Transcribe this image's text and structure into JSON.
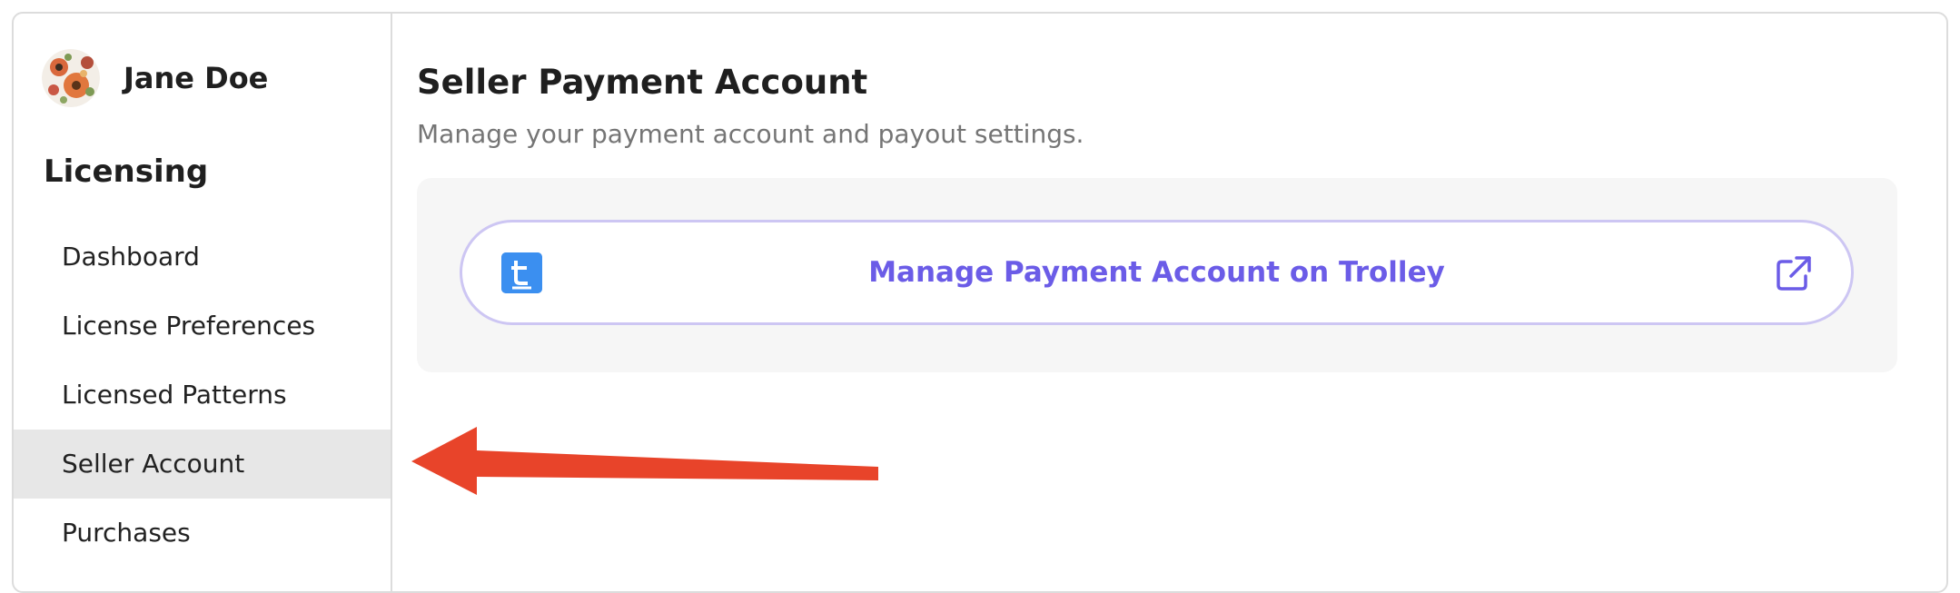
{
  "user": {
    "name": "Jane Doe",
    "avatar_icon": "floral-avatar"
  },
  "sidebar": {
    "section_title": "Licensing",
    "items": [
      {
        "label": "Dashboard",
        "active": false
      },
      {
        "label": "License Preferences",
        "active": false
      },
      {
        "label": "Licensed Patterns",
        "active": false
      },
      {
        "label": "Seller Account",
        "active": true
      },
      {
        "label": "Purchases",
        "active": false
      }
    ]
  },
  "main": {
    "title": "Seller Payment Account",
    "subtitle": "Manage your payment account and payout settings.",
    "payment_button": {
      "label": "Manage Payment Account on Trolley",
      "left_icon": "trolley-logo-icon",
      "right_icon": "external-link-icon"
    }
  },
  "colors": {
    "accent": "#6b5ce7",
    "button_border": "#cdc6f3",
    "trolley_blue": "#3b8ff0",
    "active_nav_bg": "#e7e7e7",
    "annotation_arrow": "#e8442a"
  }
}
